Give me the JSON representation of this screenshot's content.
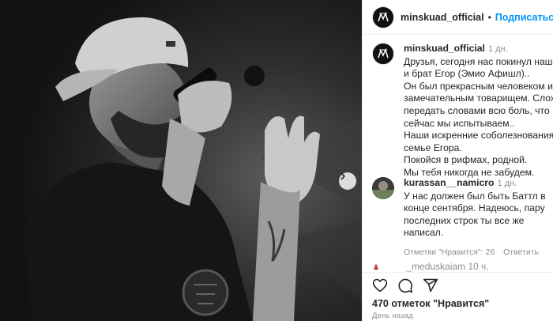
{
  "post": {
    "username": "minskuad_official",
    "follow_label": "Подписаться",
    "header_separator": "•"
  },
  "caption": {
    "username": "minskuad_official",
    "time": "1 дн.",
    "lines": [
      "Друзья, сегодня нас покинул наш друг",
      "и брат Егор (Эмио Афишл)..",
      "Он был прекрасным человеком и",
      "замечательным товарищем. Сложно",
      "передать словами всю боль, что",
      "сейчас мы испытываем..",
      "Наши искренние соболезнования",
      "семье Егора.",
      "Покойся в рифмах, родной.",
      "Мы тебя никогда не забудем."
    ]
  },
  "comment": {
    "username": "kurassan__namicro",
    "time": "1 дн.",
    "lines": [
      "У нас должен был быть Баттл в",
      "конце сентября. Надеюсь, пару",
      "последних строк ты все же",
      "написал."
    ],
    "likes_label": "Отметки \"Нравится\": 26",
    "reply_label": "Ответить"
  },
  "next_comment_peek": {
    "text": "_meduskaiam 10 ч."
  },
  "actions": {
    "likes_text": "470 отметок \"Нравится\"",
    "time_ago": "День назад"
  },
  "colors": {
    "accent": "#0095f6",
    "text": "#262626",
    "muted": "#8e8e8e"
  },
  "icons": [
    "heart-icon",
    "comment-icon",
    "share-icon",
    "chevron-right-icon",
    "logo-icon"
  ]
}
